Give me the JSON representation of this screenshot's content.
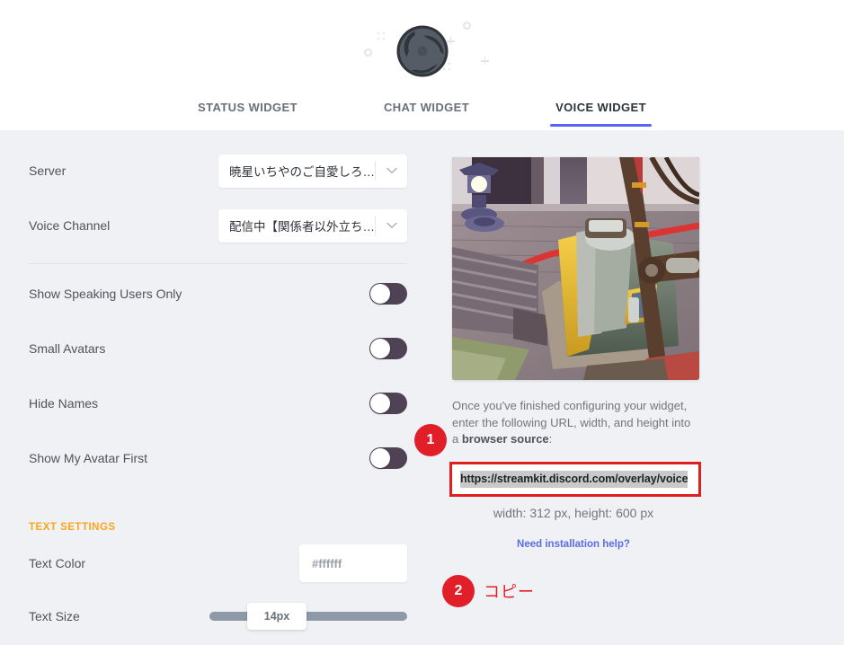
{
  "header": {
    "logo_name": "obs-logo"
  },
  "tabs": [
    {
      "label": "STATUS WIDGET",
      "active": false
    },
    {
      "label": "CHAT WIDGET",
      "active": false
    },
    {
      "label": "VOICE WIDGET",
      "active": true
    }
  ],
  "settings": {
    "server": {
      "label": "Server",
      "value": "暁星いちやのご自愛しろ…"
    },
    "voice_channel": {
      "label": "Voice Channel",
      "value": "配信中【関係者以外立ち…"
    },
    "toggles": [
      {
        "label": "Show Speaking Users Only",
        "state": "off"
      },
      {
        "label": "Small Avatars",
        "state": "off"
      },
      {
        "label": "Hide Names",
        "state": "off"
      },
      {
        "label": "Show My Avatar First",
        "state": "off"
      }
    ],
    "text_settings": {
      "section_label": "TEXT SETTINGS",
      "text_color": {
        "label": "Text Color",
        "value": "#ffffff",
        "placeholder": "#ffffff"
      },
      "text_size": {
        "label": "Text Size",
        "value": "14px"
      }
    }
  },
  "preview": {
    "alt": "widget-preview-game-screenshot"
  },
  "instructions": {
    "line1": "Once you've finished configuring your widget,",
    "line2": "enter the following URL, width, and height into",
    "line3_prefix": "a ",
    "line3_bold": "browser source",
    "line3_suffix": ":",
    "url": "https://streamkit.discord.com/overlay/voice",
    "dimensions": "width: 312 px, height: 600 px",
    "help_link": "Need installation help?"
  },
  "annotations": [
    {
      "number": "1",
      "text": ""
    },
    {
      "number": "2",
      "text": "コピー"
    }
  ],
  "colors": {
    "accent_blue": "#5865f2",
    "section_orange": "#faa61a",
    "annotation_red": "#e01f29",
    "toggle_off": "#4f4254",
    "page_bg": "#eff1f5",
    "header_bg": "#ffffff"
  }
}
